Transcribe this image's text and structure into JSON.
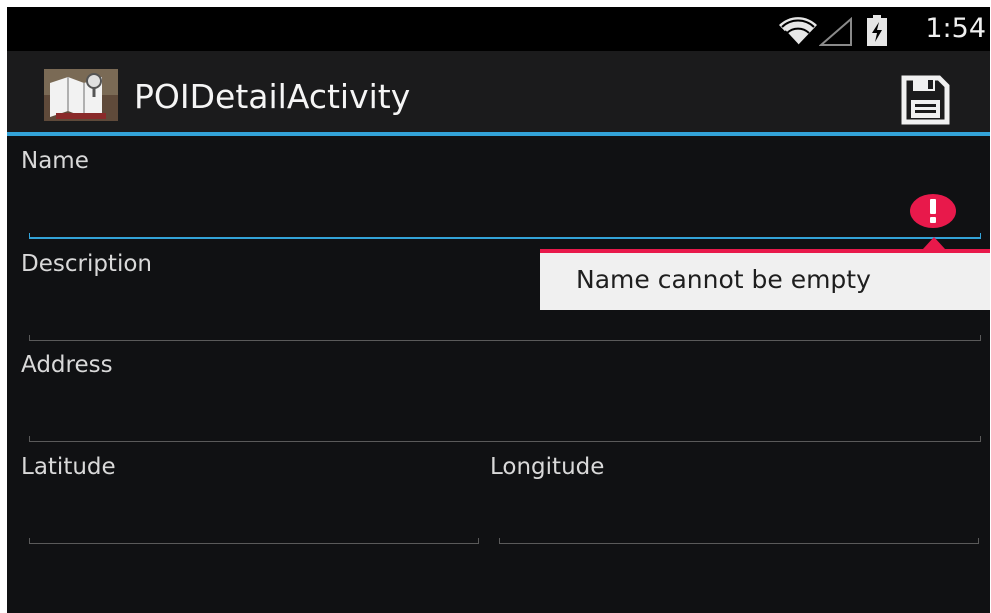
{
  "status_bar": {
    "time": "1:54",
    "wifi_icon": "wifi-icon",
    "signal_icon": "cell-signal-icon",
    "battery_icon": "battery-charging-icon"
  },
  "action_bar": {
    "title": "POIDetailActivity",
    "app_icon": "map-app-icon",
    "save_icon": "save-icon",
    "accent_color": "#33a3d8"
  },
  "form": {
    "name": {
      "label": "Name",
      "value": "",
      "error": "Name cannot be empty"
    },
    "description": {
      "label": "Description",
      "value": ""
    },
    "address": {
      "label": "Address",
      "value": ""
    },
    "latitude": {
      "label": "Latitude",
      "value": ""
    },
    "longitude": {
      "label": "Longitude",
      "value": ""
    }
  },
  "colors": {
    "background": "#101113",
    "error": "#e8194b",
    "accent": "#33a3d8"
  }
}
